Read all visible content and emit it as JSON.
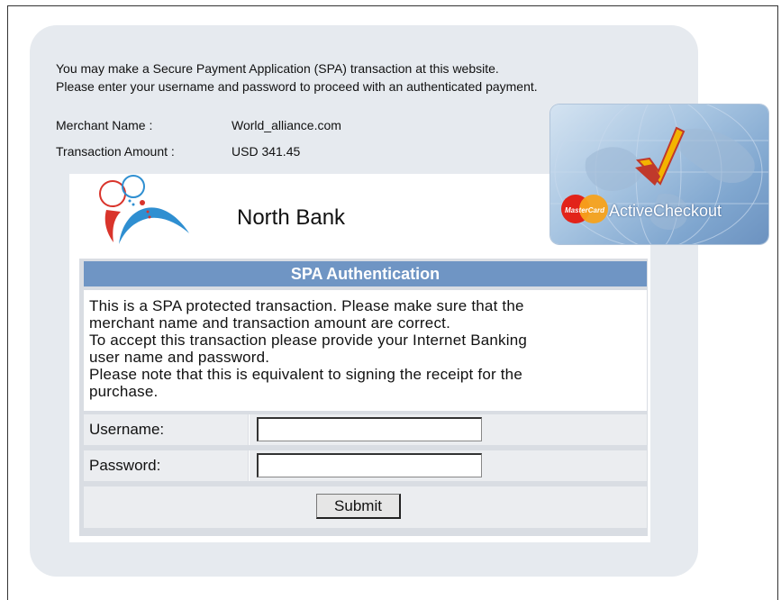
{
  "intro": {
    "line1": "You may make a Secure Payment Application (SPA) transaction at this website.",
    "line2": "Please enter your username and password to proceed with an authenticated payment."
  },
  "merchant": {
    "label": "Merchant Name :",
    "value": "World_alliance.com"
  },
  "amount": {
    "label": "Transaction Amount :",
    "value": "USD 341.45"
  },
  "bank": {
    "name": "North Bank"
  },
  "card": {
    "brand": "MasterCard",
    "product": "ActiveCheckout"
  },
  "auth": {
    "title": "SPA Authentication",
    "notice": [
      "This is a SPA protected transaction. Please make sure that the",
      "merchant name and transaction amount are correct.",
      "To accept this transaction please provide your Internet Banking",
      "user name and password.",
      "Please note that this is equivalent to signing the receipt for the",
      "purchase."
    ],
    "username_label": "Username:",
    "username_value": "",
    "password_label": "Password:",
    "password_value": "",
    "submit_label": "Submit"
  },
  "colors": {
    "panel": "#e6eaef",
    "header": "#6f95c4",
    "logo_red": "#d9342b",
    "logo_blue": "#2f8fd1"
  }
}
